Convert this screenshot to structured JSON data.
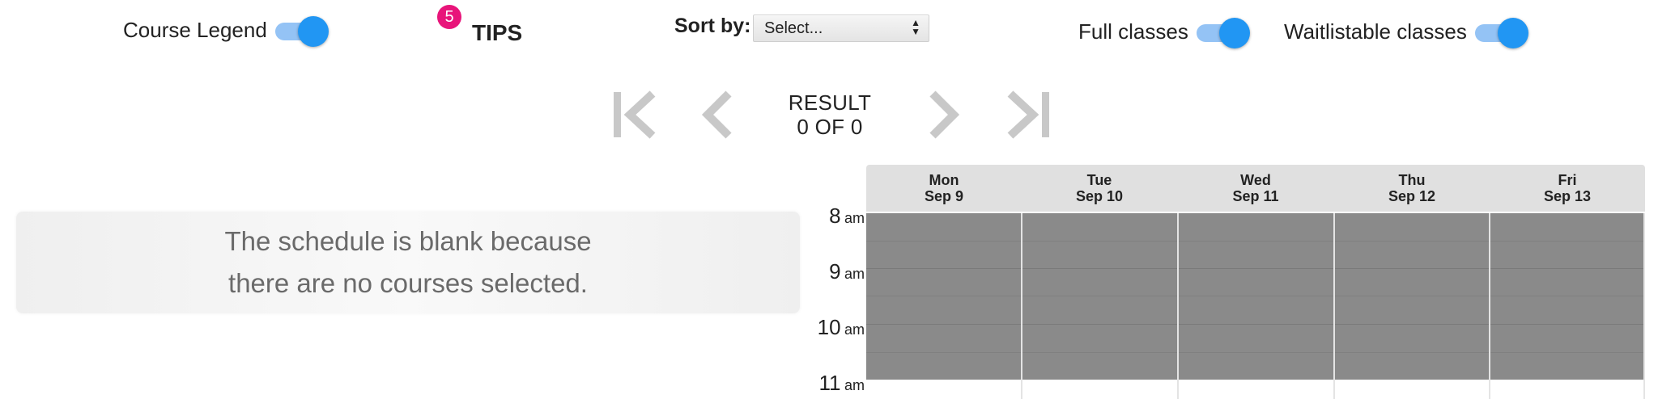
{
  "toolbar": {
    "course_legend_label": "Course Legend",
    "course_legend_on": true,
    "tips_count": "5",
    "tips_label": "TIPS",
    "sort_label": "Sort by:",
    "sort_value": "Select...",
    "full_classes_label": "Full classes",
    "full_classes_on": true,
    "waitlistable_label": "Waitlistable classes",
    "waitlistable_on": true
  },
  "pager": {
    "result_label": "RESULT",
    "result_count": "0 OF 0"
  },
  "message": {
    "line1": "The schedule is blank because",
    "line2": "there are no courses selected."
  },
  "calendar": {
    "days": [
      {
        "name": "Mon",
        "date": "Sep 9"
      },
      {
        "name": "Tue",
        "date": "Sep 10"
      },
      {
        "name": "Wed",
        "date": "Sep 11"
      },
      {
        "name": "Thu",
        "date": "Sep 12"
      },
      {
        "name": "Fri",
        "date": "Sep 13"
      }
    ],
    "times": [
      {
        "hour": "8",
        "ampm": "am"
      },
      {
        "hour": "9",
        "ampm": "am"
      },
      {
        "hour": "10",
        "ampm": "am"
      },
      {
        "hour": "11",
        "ampm": "am"
      }
    ]
  },
  "colors": {
    "toggle_accent": "#2196f3",
    "badge": "#e8157a",
    "blocked_time": "#8a8a8a"
  }
}
